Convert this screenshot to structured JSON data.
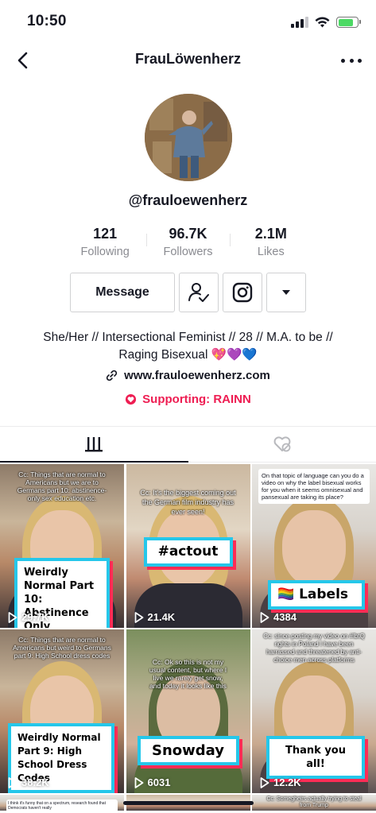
{
  "status_bar": {
    "time": "10:50",
    "icons": [
      "signal-icon",
      "wifi-icon",
      "battery-charging-icon"
    ]
  },
  "nav": {
    "title": "FrauLöwenherz",
    "back_icon": "chevron-left-icon",
    "more_icon": "more-dots-icon"
  },
  "profile": {
    "handle": "@frauloewenherz",
    "stats": [
      {
        "value": "121",
        "label": "Following"
      },
      {
        "value": "96.7K",
        "label": "Followers"
      },
      {
        "value": "2.1M",
        "label": "Likes"
      }
    ],
    "message_label": "Message",
    "bio_line1": "She/Her // Intersectional Feminist // 28 // M.A. to be //",
    "bio_line2": "Raging Bisexual 💖💜💙",
    "link": "www.frauloewenherz.com",
    "supporting": "Supporting: RAINN"
  },
  "tabs": [
    {
      "icon": "grid-icon",
      "active": true
    },
    {
      "icon": "liked-videos-hidden-icon",
      "active": false
    }
  ],
  "videos": [
    {
      "caption": "Cc: Things that are normal to Americans but we are to Germans part 10: abstinence-only sex education etc.",
      "sticker": "Weirdly Normal Part 10: Abstinence Only",
      "views": "29.7K"
    },
    {
      "caption": "Cc: It's the biggest coming out the German film industry has ever seen!",
      "sticker": "#actout",
      "views": "21.4K"
    },
    {
      "caption": "On that topic of language can you do a video on why the label bisexual works for you when it seems omnisexual and pansexual are taking its place?",
      "sticker": "🏳️‍🌈 Labels",
      "views": "4384"
    },
    {
      "caption": "Cc: Things that are normal to Americans but weird to Germans part 9: High School dress codes",
      "sticker": "Weirdly Normal Part 9: High School Dress Codes",
      "views": "38.2K"
    },
    {
      "caption": "Cc: Ok so this is not my usual content, but where I live we rarely get snow, and today it looks like this",
      "sticker": "Snowday",
      "views": "6031"
    },
    {
      "caption": "Cc: since posting my video on #lbtQ rights in Poland I have been harrassed and threatened by anti-choice men across platforms",
      "sticker": "Thank you all!",
      "views": "12.2K"
    },
    {
      "caption": "I think it's funny that on a spectrum, research found that Democrats haven't really",
      "sticker": "",
      "views": ""
    },
    {
      "caption": "",
      "sticker": "",
      "views": ""
    },
    {
      "caption": "Cc: Somegheirs actually trying to steal from Trump",
      "sticker": "",
      "views": ""
    }
  ],
  "colors": {
    "accent_red": "#ee1d52",
    "sticker_blue": "#25c7ea",
    "sticker_pink": "#fe2c55"
  }
}
